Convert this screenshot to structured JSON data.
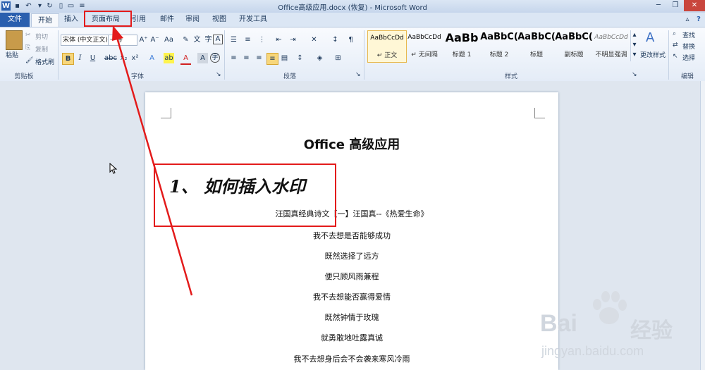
{
  "titlebar": {
    "title": "Office高级应用.docx (恢复) - Microsoft Word"
  },
  "tabs": [
    "文件",
    "开始",
    "插入",
    "页面布局",
    "引用",
    "邮件",
    "审阅",
    "视图",
    "开发工具"
  ],
  "clipboard": {
    "paste": "粘贴",
    "cut": "剪切",
    "copy": "复制",
    "format_painter": "格式刷",
    "group": "剪贴板"
  },
  "font": {
    "font_name": "宋体 (中文正文)",
    "font_size": "一号",
    "group": "字体"
  },
  "paragraph": {
    "group": "段落"
  },
  "styles": {
    "group": "样式",
    "items": [
      {
        "sample": "AaBbCcDd",
        "name": "↵ 正文"
      },
      {
        "sample": "AaBbCcDd",
        "name": "↵ 无间隔"
      },
      {
        "sample": "AaBb",
        "name": "标题 1"
      },
      {
        "sample": "AaBbC(",
        "name": "标题 2"
      },
      {
        "sample": "AaBbC(",
        "name": "标题"
      },
      {
        "sample": "AaBbC(",
        "name": "副标题"
      },
      {
        "sample": "AaBbCcDd",
        "name": "不明显强调"
      }
    ],
    "change_styles": "更改样式"
  },
  "editing": {
    "find": "查找",
    "replace": "替换",
    "select": "选择",
    "group": "编辑"
  },
  "document": {
    "title": "Office 高级应用",
    "heading": "1、 如何插入水印",
    "lines": [
      "汪国真经典诗文【一】汪国真--《热爱生命》",
      "我不去想是否能够成功",
      "既然选择了远方",
      "便只顾风雨兼程",
      "我不去想能否赢得爱情",
      "既然钟情于玫瑰",
      "就勇敢地吐露真诚",
      "我不去想身后会不会袭来寒风冷雨"
    ]
  },
  "watermark": {
    "brand": "Bai",
    "brand2": "经验",
    "url": "jingyan.baidu.com"
  },
  "colors": {
    "annotation_red": "#e31b1b",
    "file_tab": "#2a5fae"
  }
}
